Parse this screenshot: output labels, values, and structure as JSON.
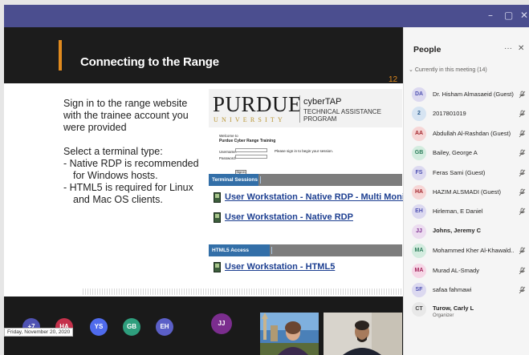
{
  "window": {
    "controls": [
      "–",
      "▢",
      "✕"
    ]
  },
  "slide": {
    "title": "Connecting to the Range",
    "number": "12",
    "para1": "Sign in to the range website with the trainee account you were provided",
    "para2": "Select a terminal type:",
    "bullets": [
      "- Native RDP is recommended for Windows hosts.",
      "- HTML5 is required for Linux and Mac OS clients."
    ]
  },
  "purdue": {
    "logo": "PURDUE",
    "university": "UNIVERSITY",
    "cyber": "cyberTAP",
    "program": "TECHNICAL ASSISTANCE PROGRAM",
    "welcome": "Welcome to",
    "site_title": "Purdue Cyber Range Training",
    "username_label": "Username:",
    "password_label": "Password:",
    "hint": "Please sign in to begin your session.",
    "signin_label": "Sign In",
    "terminal_sessions": "Terminal Sessions",
    "ws_multi": "User Workstation - Native RDP - Multi Monitor",
    "ws_native": "User Workstation - Native RDP",
    "html5_sessions": "HTML5 Access Sessions",
    "ws_html5": "User Workstation - HTML5"
  },
  "participants_bar": {
    "avatars": [
      {
        "initials": "+7",
        "color": "#4f52b2"
      },
      {
        "initials": "HA",
        "color": "#c4314b"
      },
      {
        "initials": "YS",
        "color": "#4f6bed"
      },
      {
        "initials": "GB",
        "color": "#2e9e7d"
      },
      {
        "initials": "EH",
        "color": "#5b5fc7"
      },
      {
        "initials": "JJ",
        "color": "#7b2d8e"
      }
    ],
    "date": "Friday, November 20, 2020"
  },
  "people": {
    "title": "People",
    "more_icon": "more-icon",
    "close_icon": "close-icon",
    "section": "Currently in this meeting (14)",
    "members": [
      {
        "initials": "DA",
        "name": "Dr. Hisham Almasaeid (Guest)",
        "bg": "#dcd9f0",
        "fg": "#4f52b2",
        "bold": false,
        "sub": ""
      },
      {
        "initials": "2",
        "name": "2017801019",
        "bg": "#d6e4f2",
        "fg": "#2a5b8c",
        "bold": false,
        "sub": ""
      },
      {
        "initials": "AA",
        "name": "Abdullah Al-Rashdan (Guest)",
        "bg": "#f6d6d6",
        "fg": "#a4262c",
        "bold": false,
        "sub": ""
      },
      {
        "initials": "GB",
        "name": "Bailey, George A",
        "bg": "#d3ecdf",
        "fg": "#2e7d5b",
        "bold": false,
        "sub": ""
      },
      {
        "initials": "FS",
        "name": "Feras Sami (Guest)",
        "bg": "#dcd9f0",
        "fg": "#4f52b2",
        "bold": false,
        "sub": ""
      },
      {
        "initials": "HA",
        "name": "HAZIM ALSMADI (Guest)",
        "bg": "#f6d6d6",
        "fg": "#a4262c",
        "bold": false,
        "sub": ""
      },
      {
        "initials": "EH",
        "name": "Hirleman, E Daniel",
        "bg": "#dcd9f0",
        "fg": "#4f52b2",
        "bold": false,
        "sub": ""
      },
      {
        "initials": "JJ",
        "name": "Johns, Jeremy C",
        "bg": "#ecdcf0",
        "fg": "#7b2d8e",
        "bold": true,
        "sub": ""
      },
      {
        "initials": "MA",
        "name": "Mohammed Kher Al-Khawald..",
        "bg": "#d3ecdf",
        "fg": "#2e7d5b",
        "bold": false,
        "sub": ""
      },
      {
        "initials": "MA",
        "name": "Murad AL-Smady",
        "bg": "#f6d6e6",
        "fg": "#a4265c",
        "bold": false,
        "sub": ""
      },
      {
        "initials": "SF",
        "name": "safaa fahmawi",
        "bg": "#dcd9f0",
        "fg": "#4f52b2",
        "bold": false,
        "sub": ""
      },
      {
        "initials": "CT",
        "name": "Turow, Carly L",
        "bg": "#e8e8e8",
        "fg": "#444444",
        "bold": true,
        "sub": "Organizer"
      }
    ]
  }
}
